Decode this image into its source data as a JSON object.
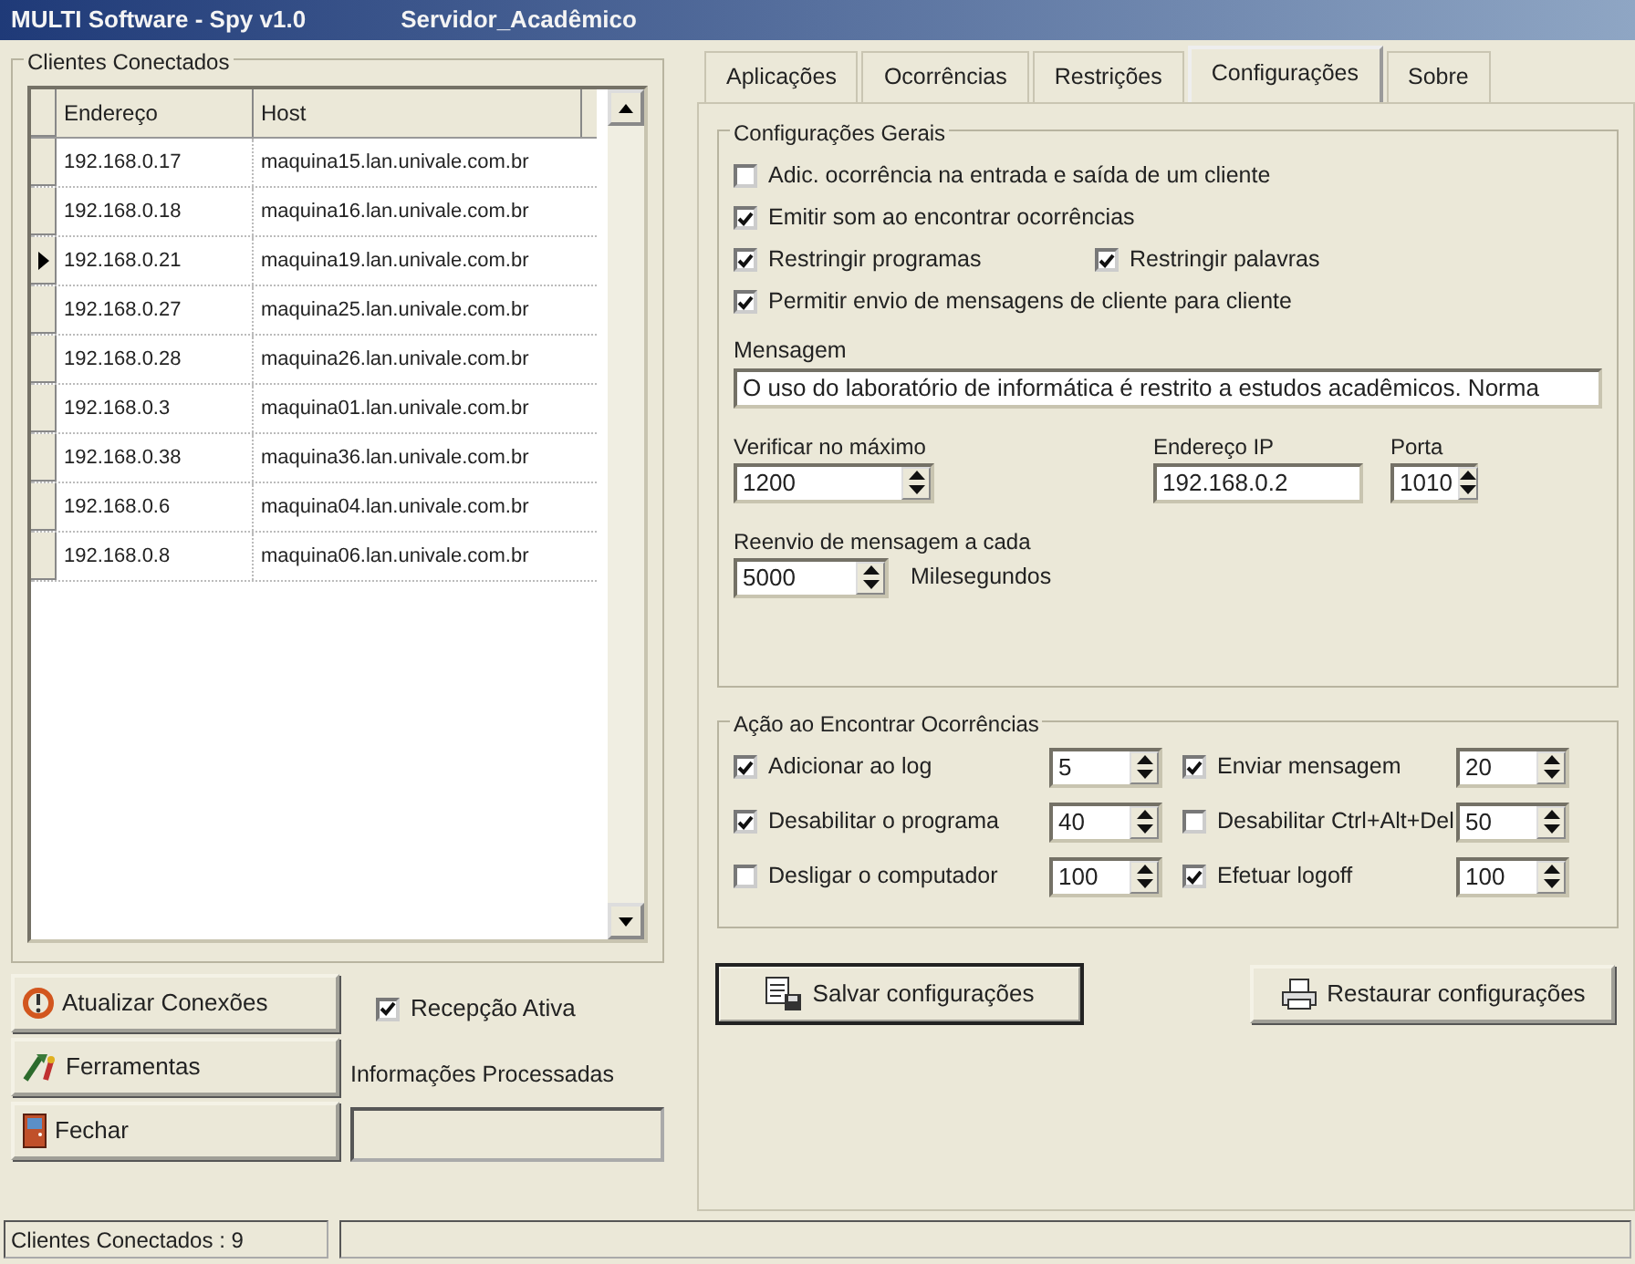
{
  "window": {
    "title": "MULTI Software - Spy v1.0",
    "subtitle": "Servidor_Acadêmico"
  },
  "clients": {
    "title": "Clientes Conectados",
    "columns": [
      "Endereço",
      "Host"
    ],
    "rows": [
      {
        "address": "192.168.0.17",
        "host": "maquina15.lan.univale.com.br",
        "selected": false
      },
      {
        "address": "192.168.0.18",
        "host": "maquina16.lan.univale.com.br",
        "selected": false
      },
      {
        "address": "192.168.0.21",
        "host": "maquina19.lan.univale.com.br",
        "selected": true
      },
      {
        "address": "192.168.0.27",
        "host": "maquina25.lan.univale.com.br",
        "selected": false
      },
      {
        "address": "192.168.0.28",
        "host": "maquina26.lan.univale.com.br",
        "selected": false
      },
      {
        "address": "192.168.0.3",
        "host": "maquina01.lan.univale.com.br",
        "selected": false
      },
      {
        "address": "192.168.0.38",
        "host": "maquina36.lan.univale.com.br",
        "selected": false
      },
      {
        "address": "192.168.0.6",
        "host": "maquina04.lan.univale.com.br",
        "selected": false
      },
      {
        "address": "192.168.0.8",
        "host": "maquina06.lan.univale.com.br",
        "selected": false
      }
    ]
  },
  "left_buttons": [
    {
      "label": "Atualizar Conexões"
    },
    {
      "label": "Ferramentas"
    },
    {
      "label": "Fechar"
    }
  ],
  "reception": {
    "label": "Recepção Ativa",
    "checked": true
  },
  "processed": {
    "label": "Informações Processadas"
  },
  "tabs": [
    {
      "label": "Aplicações",
      "selected": false
    },
    {
      "label": "Ocorrências",
      "selected": false
    },
    {
      "label": "Restrições",
      "selected": false
    },
    {
      "label": "Configurações",
      "selected": true
    },
    {
      "label": "Sobre",
      "selected": false
    }
  ],
  "general": {
    "title": "Configurações Gerais",
    "options": [
      [
        {
          "label": "Adic. ocorrência na entrada e saída de um cliente",
          "checked": false
        }
      ],
      [
        {
          "label": "Emitir som ao encontrar ocorrências",
          "checked": true
        }
      ],
      [
        {
          "label": "Restringir programas",
          "checked": true
        },
        {
          "label": "Restringir palavras",
          "checked": true
        }
      ],
      [
        {
          "label": "Permitir envio de mensagens de cliente para cliente",
          "checked": true
        }
      ]
    ],
    "message_label": "Mensagem",
    "message": "O uso do laboratório de informática é restrito a estudos acadêmicos. Norma",
    "check_max_label": "Verificar no máximo",
    "check_max": "1200",
    "ip_label": "Endereço IP",
    "ip": "192.168.0.2",
    "port_label": "Porta",
    "port": "1010",
    "resend_label": "Reenvio de mensagem a cada",
    "resend": "5000",
    "resend_unit": "Milesegundos"
  },
  "actions": {
    "title": "Ação ao Encontrar Ocorrências",
    "items": [
      {
        "label": "Adicionar ao log",
        "checked": true,
        "value": "5"
      },
      {
        "label": "Enviar mensagem",
        "checked": true,
        "value": "20"
      },
      {
        "label": "Desabilitar o programa",
        "checked": true,
        "value": "40"
      },
      {
        "label": "Desabilitar Ctrl+Alt+Del",
        "checked": false,
        "value": "50"
      },
      {
        "label": "Desligar o computador",
        "checked": false,
        "value": "100"
      },
      {
        "label": "Efetuar logoff",
        "checked": true,
        "value": "100"
      }
    ]
  },
  "bottom_buttons": [
    {
      "label": "Salvar configurações",
      "default": true
    },
    {
      "label": "Restaurar configurações",
      "default": false
    }
  ],
  "status_bar": "Clientes Conectados : 9"
}
